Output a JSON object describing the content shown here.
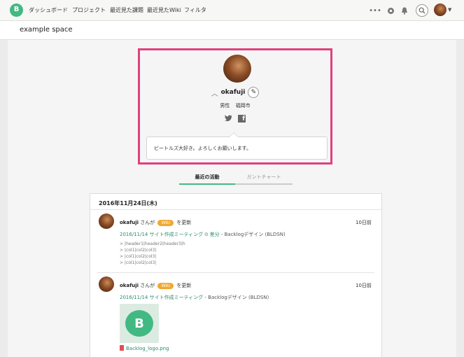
{
  "nav": {
    "logo_letter": "B",
    "items": [
      "ダッシュボード",
      "プロジェクト",
      "最近見た課題",
      "最近見たWiki",
      "フィルタ"
    ],
    "icons": [
      "more-icon",
      "watch-icon",
      "notification-bell-icon",
      "search-icon",
      "user-avatar"
    ]
  },
  "space": {
    "name": "example space"
  },
  "profile": {
    "username": "okafuji",
    "gender": "男性",
    "location": "福岡市",
    "bio": "ビートルズ大好き。よろしくお願いします。"
  },
  "tabs": [
    {
      "label": "最近の活動",
      "active": true
    },
    {
      "label": "ガントチャート",
      "active": false
    }
  ],
  "activity": {
    "date": "2016年11月24日(木)",
    "entries": [
      {
        "user": "okafuji",
        "san": "さんが",
        "badge": "Wiki",
        "action": "を更新",
        "time": "10日前",
        "page": "2016/11/14 サイト作成ミーティング",
        "diff": "差分",
        "project": "- Backlogデザイン (BLDSN)",
        "quotes": [
          "> |header1|header2|header3|h",
          "> |col1|col2|col3|",
          "> |col1|col2|col3|",
          "> |col1|col2|col3|"
        ]
      },
      {
        "user": "okafuji",
        "san": "さんが",
        "badge": "Wiki",
        "action": "を更新",
        "time": "10日前",
        "page": "2016/11/14 サイト作成ミーティング",
        "project": "- Backlogデザイン (BLDSN)",
        "attachment_letter": "B",
        "attachment": "Backlog_logo.png"
      }
    ]
  },
  "colors": {
    "brand": "#42b983",
    "highlight": "#e0407d",
    "wiki_badge": "#f0a830",
    "link": "#2a8c6e"
  }
}
